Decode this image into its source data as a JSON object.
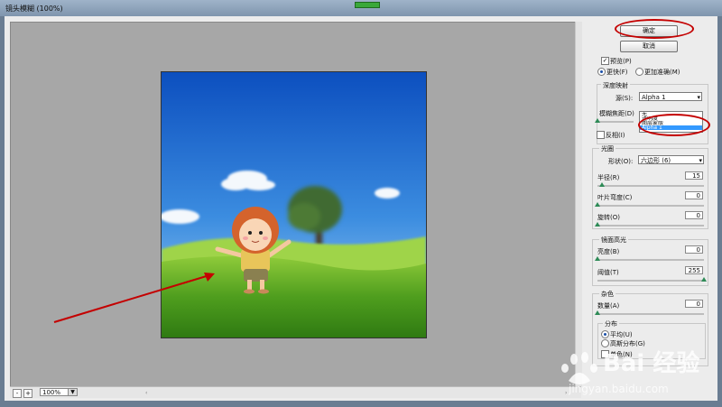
{
  "window": {
    "title": "镜头模糊 (100%)"
  },
  "zoom": {
    "minus": "-",
    "plus": "+",
    "value": "100%",
    "arrow": "▼"
  },
  "panel": {
    "ok": "确定",
    "cancel": "取消",
    "preview": {
      "label": "预览(P)",
      "checked": true
    },
    "quality": {
      "faster": "更快(F)",
      "more_accurate": "更加准确(M)",
      "selected": "faster"
    },
    "depth_map": {
      "group_title": "深度映射",
      "source_label": "源(S):",
      "source_value": "Alpha 1",
      "source_options": [
        "无",
        "透明度",
        "图层蒙版",
        "Alpha 1"
      ],
      "blur_focal_label": "模糊焦距(D)",
      "invert_label": "反相(I)"
    },
    "iris": {
      "group_title": "光圈",
      "shape_label": "形状(O):",
      "shape_value": "六边形 (6)",
      "radius_label": "半径(R)",
      "radius_value": "15",
      "blade_label": "叶片弯度(C)",
      "blade_value": "0",
      "rotation_label": "旋转(O)",
      "rotation_value": "0"
    },
    "specular": {
      "group_title": "镜面高光",
      "brightness_label": "亮度(B)",
      "brightness_value": "0",
      "threshold_label": "阈值(T)",
      "threshold_value": "255"
    },
    "noise": {
      "group_title": "杂色",
      "amount_label": "数量(A)",
      "amount_value": "0",
      "distribution_title": "分布",
      "uniform": "平均(U)",
      "gaussian": "高斯分布(G)",
      "mono": "单色(N)"
    }
  },
  "watermark": {
    "text": "Bai 经验",
    "url": "jingyan.baidu.com"
  },
  "colors": {
    "annotation_red": "#c40000",
    "selection_blue": "#3399ff",
    "slider_thumb": "#2e8b57"
  }
}
